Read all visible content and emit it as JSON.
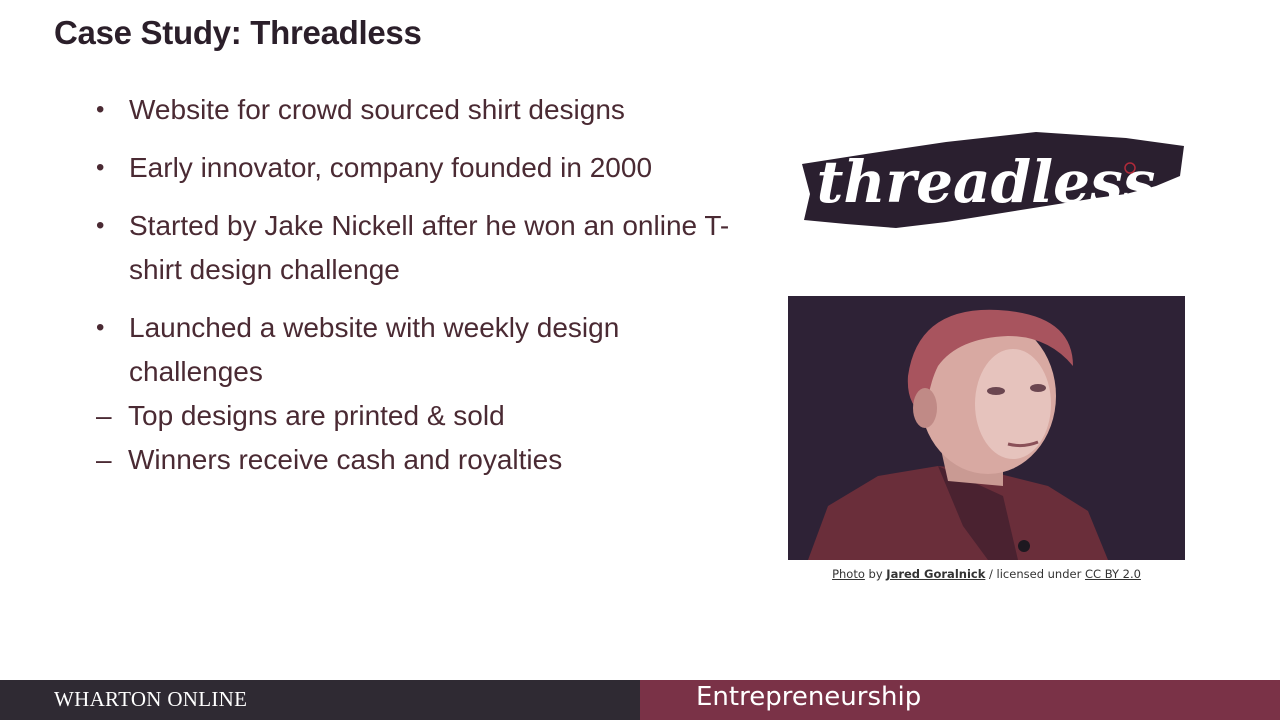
{
  "slide": {
    "title": "Case Study: Threadless",
    "bullets": [
      "Website for crowd sourced shirt designs",
      "Early innovator, company founded in 2000",
      "Started by Jake Nickell after he won an online T-shirt design challenge",
      "Launched a website with weekly design challenges"
    ],
    "sub_bullets": [
      "Top designs are printed & sold",
      "Winners receive cash and royalties"
    ],
    "bullet_marker": "•",
    "sub_marker": "–"
  },
  "logo": {
    "text": "threadless",
    "color": "#2a1f2f",
    "icon": "threadless-logo"
  },
  "photo": {
    "icon": "portrait-photo"
  },
  "credit": {
    "photo_link": "Photo",
    "by": "by",
    "author": "Jared Goralnick",
    "licensed": "/ licensed under",
    "license": "CC BY 2.0"
  },
  "footer": {
    "left": "WHARTON ONLINE",
    "right": "Entrepreneurship",
    "left_color": "#2f2a33",
    "right_color": "#7a3247"
  }
}
